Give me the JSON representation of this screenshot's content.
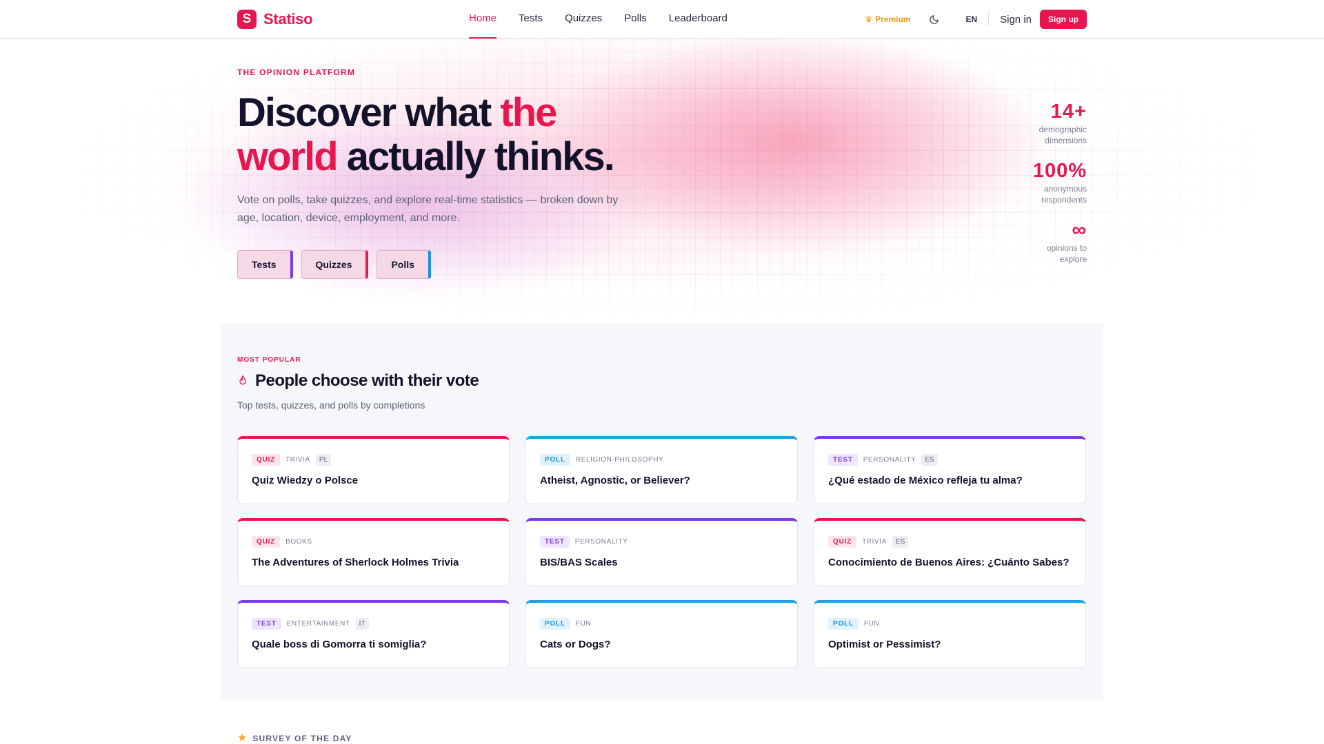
{
  "header": {
    "logo_letter": "S",
    "logo_text": "Statiso",
    "nav": [
      {
        "label": "Home"
      },
      {
        "label": "Tests"
      },
      {
        "label": "Quizzes"
      },
      {
        "label": "Polls"
      },
      {
        "label": "Leaderboard"
      }
    ],
    "premium_label": "Premium",
    "lang": "EN",
    "signin_label": "Sign in",
    "signup_label": "Sign up"
  },
  "hero": {
    "eyebrow": "THE OPINION PLATFORM",
    "headline_part1": "Discover what ",
    "headline_accent1": "the",
    "headline_accent2": "world",
    "headline_part2": " actually thinks.",
    "subtext": "Vote on polls, take quizzes, and explore real-time statistics — broken down by age, location, device, employment, and more.",
    "buttons": [
      {
        "label": "Tests"
      },
      {
        "label": "Quizzes"
      },
      {
        "label": "Polls"
      }
    ],
    "stats": [
      {
        "value": "14+",
        "label_line1": "demographic",
        "label_line2": "dimensions"
      },
      {
        "value": "100%",
        "label_line1": "anonymous",
        "label_line2": "respondents"
      },
      {
        "value": "∞",
        "label_line1": "opinions to",
        "label_line2": "explore"
      }
    ]
  },
  "popular": {
    "eyebrow": "MOST POPULAR",
    "title": "People choose with their vote",
    "subtitle": "Top tests, quizzes, and polls by completions",
    "cards": [
      {
        "type": "QUIZ",
        "category": "TRIVIA",
        "lang": "PL",
        "title": "Quiz Wiedzy o Polsce"
      },
      {
        "type": "POLL",
        "category": "RELIGION-PHILOSOPHY",
        "lang": "",
        "title": "Atheist, Agnostic, or Believer?"
      },
      {
        "type": "TEST",
        "category": "PERSONALITY",
        "lang": "ES",
        "title": "¿Qué estado de México refleja tu alma?"
      },
      {
        "type": "QUIZ",
        "category": "BOOKS",
        "lang": "",
        "title": "The Adventures of Sherlock Holmes Trivia"
      },
      {
        "type": "TEST",
        "category": "PERSONALITY",
        "lang": "",
        "title": "BIS/BAS Scales"
      },
      {
        "type": "QUIZ",
        "category": "TRIVIA",
        "lang": "ES",
        "title": "Conocimiento de Buenos Aires: ¿Cuánto Sabes?"
      },
      {
        "type": "TEST",
        "category": "ENTERTAINMENT",
        "lang": "IT",
        "title": "Quale boss di Gomorra ti somiglia?"
      },
      {
        "type": "POLL",
        "category": "FUN",
        "lang": "",
        "title": "Cats or Dogs?"
      },
      {
        "type": "POLL",
        "category": "FUN",
        "lang": "",
        "title": "Optimist or Pessimist?"
      }
    ]
  },
  "survey_of_day": {
    "label": "SURVEY OF THE DAY"
  },
  "colors": {
    "brand": "#e8164f",
    "quiz": "#e8164f",
    "test": "#7c3aed",
    "poll": "#1ba3e8",
    "premium": "#e89a0d"
  }
}
